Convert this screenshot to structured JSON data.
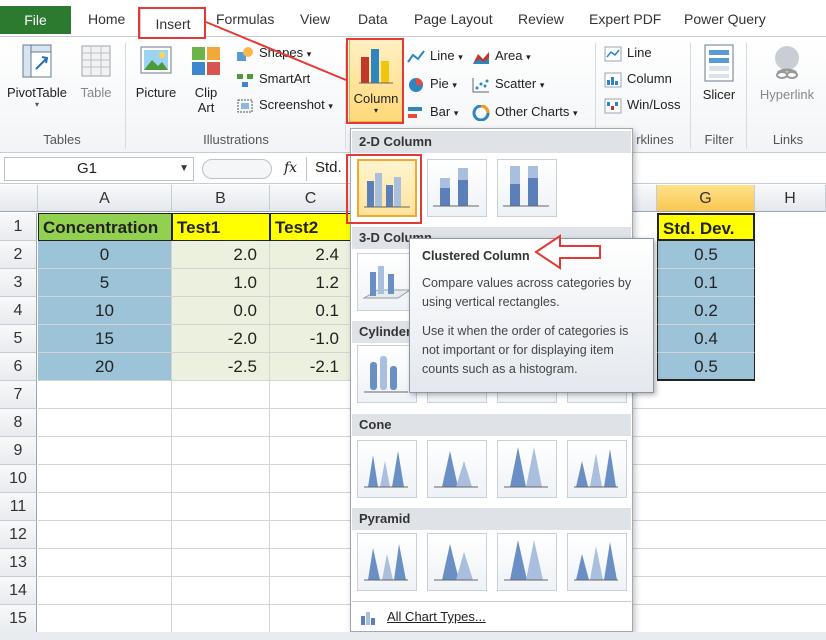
{
  "tabs": {
    "file": "File",
    "home": "Home",
    "insert": "Insert",
    "formulas": "Formulas",
    "view": "View",
    "data": "Data",
    "page_layout": "Page Layout",
    "review": "Review",
    "expert_pdf": "Expert PDF",
    "power_query": "Power Query"
  },
  "ribbon": {
    "pivottable": "PivotTable",
    "table": "Table",
    "tables_group": "Tables",
    "picture": "Picture",
    "clip_art_1": "Clip",
    "clip_art_2": "Art",
    "shapes": "Shapes",
    "smartart": "SmartArt",
    "screenshot": "Screenshot",
    "illustrations_group": "Illustrations",
    "column": "Column",
    "line": "Line",
    "area": "Area",
    "pie": "Pie",
    "scatter": "Scatter",
    "bar": "Bar",
    "other_charts": "Other Charts",
    "spark_line": "Line",
    "spark_column": "Column",
    "spark_winloss": "Win/Loss",
    "sparklines_group": "rklines",
    "slicer": "Slicer",
    "filter_group": "Filter",
    "hyperlink": "Hyperlink",
    "links_group": "Links"
  },
  "formula_bar": {
    "name_box": "G1",
    "fx": "fx",
    "formula": "Std."
  },
  "grid": {
    "columns": [
      "A",
      "B",
      "C",
      "G",
      "H"
    ],
    "rows": [
      "1",
      "2",
      "3",
      "4",
      "5",
      "6",
      "7",
      "8",
      "9",
      "10",
      "11",
      "12",
      "13",
      "14",
      "15"
    ],
    "headers": {
      "a": "Concentration",
      "b": "Test1",
      "c": "Test2",
      "g": "Std. Dev."
    },
    "data": [
      {
        "a": "0",
        "b": "2.0",
        "c": "2.4",
        "g": "0.5"
      },
      {
        "a": "5",
        "b": "1.0",
        "c": "1.2",
        "g": "0.1"
      },
      {
        "a": "10",
        "b": "0.0",
        "c": "0.1",
        "g": "0.2"
      },
      {
        "a": "15",
        "b": "-2.0",
        "c": "-1.0",
        "g": "0.4"
      },
      {
        "a": "20",
        "b": "-2.5",
        "c": "-2.1",
        "g": "0.5"
      }
    ]
  },
  "dropdown": {
    "sec_2d": "2-D Column",
    "sec_3d": "3-D Column",
    "sec_cyl": "Cylinder",
    "sec_cone": "Cone",
    "sec_pyr": "Pyramid",
    "all_chart_types": "All Chart Types..."
  },
  "tooltip": {
    "title": "Clustered Column",
    "line1": "Compare values across categories by using vertical rectangles.",
    "line2": "Use it when the order of categories is not important or for displaying item counts such as a histogram."
  }
}
